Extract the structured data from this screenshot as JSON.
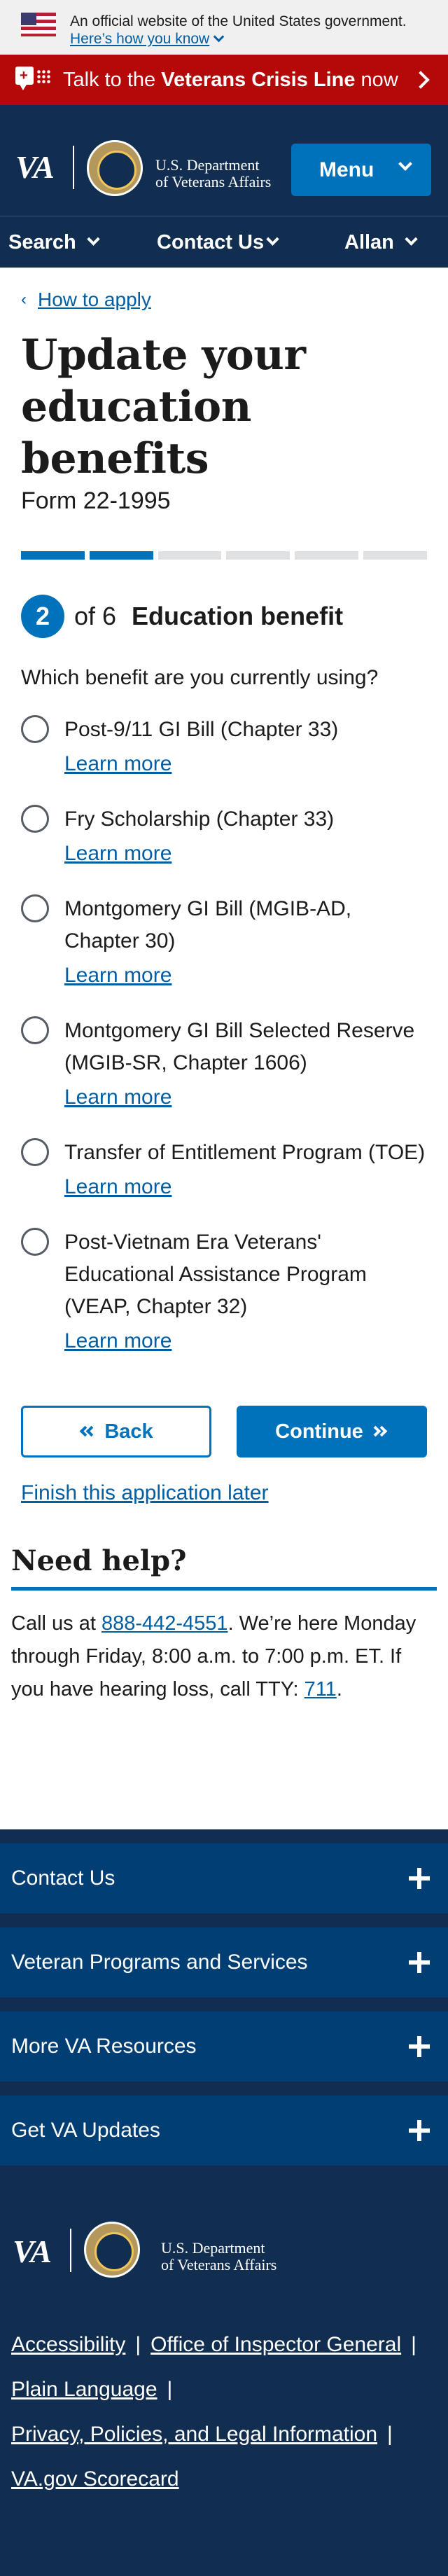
{
  "official_banner": {
    "text": "An official website of the United States government.",
    "link": "Here’s how you know"
  },
  "crisis_bar": {
    "prefix": "Talk to the ",
    "bold": "Veterans Crisis Line",
    "suffix": " now"
  },
  "header": {
    "logo": "VA",
    "dept_line1": "U.S. Department",
    "dept_line2": "of Veterans Affairs",
    "menu_label": "Menu"
  },
  "nav": {
    "search": "Search",
    "contact": "Contact Us",
    "user": "Allan"
  },
  "breadcrumb": {
    "arrow": "‹",
    "label": "How to apply"
  },
  "page": {
    "title": "Update your education benefits",
    "form_number": "Form 22-1995"
  },
  "progress": {
    "total_segments": 6,
    "completed_segments": 2
  },
  "step": {
    "number": "2",
    "of": "of 6",
    "title": "Education benefit"
  },
  "question": "Which benefit are you currently using?",
  "options": [
    {
      "label": "Post-9/11 GI Bill (Chapter 33)",
      "learn_more": "Learn more"
    },
    {
      "label": "Fry Scholarship (Chapter 33)",
      "learn_more": "Learn more"
    },
    {
      "label": "Montgomery GI Bill (MGIB-AD, Chapter 30)",
      "learn_more": "Learn more"
    },
    {
      "label": "Montgomery GI Bill Selected Reserve (MGIB-SR, Chapter 1606)",
      "learn_more": "Learn more"
    },
    {
      "label": "Transfer of Entitlement Program (TOE)",
      "learn_more": "Learn more"
    },
    {
      "label": "Post-Vietnam Era Veterans' Educational Assistance Program (VEAP, Chapter 32)",
      "learn_more": "Learn more"
    }
  ],
  "buttons": {
    "back": "Back",
    "continue": "Continue",
    "finish_later": "Finish this application later"
  },
  "help": {
    "title": "Need help?",
    "call_prefix": "Call us at ",
    "phone": "888-442-4551",
    "call_suffix": ". We’re here Monday through Friday, 8:00 a.m. to 7:00 p.m. ET. If you have hearing loss, call TTY: ",
    "tty": "711",
    "end": "."
  },
  "footer": {
    "sections": [
      "Contact Us",
      "Veteran Programs and Services",
      "More VA Resources",
      "Get VA Updates"
    ],
    "links": {
      "accessibility": "Accessibility",
      "oig": "Office of Inspector General",
      "plain_language": "Plain Language",
      "privacy": "Privacy, Policies, and Legal Information",
      "scorecard": "VA.gov Scorecard"
    }
  },
  "colors": {
    "primary": "#0071bb",
    "navy": "#112e51",
    "crisis_red": "#b50909",
    "link": "#005ea2"
  }
}
